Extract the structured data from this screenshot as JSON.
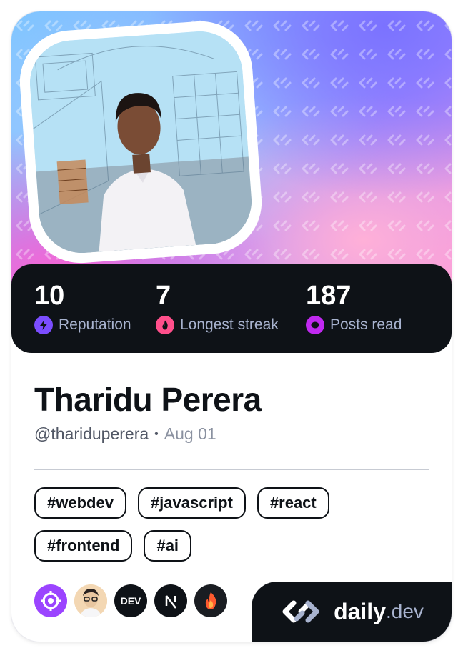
{
  "profile": {
    "name": "Tharidu Perera",
    "handle": "@thariduperera",
    "separator": "•",
    "joined": "Aug 01"
  },
  "stats": [
    {
      "value": "10",
      "label": "Reputation",
      "icon": "reputation-bolt-icon",
      "color": "#7b4dff"
    },
    {
      "value": "7",
      "label": "Longest streak",
      "icon": "streak-flame-icon",
      "color": "#ff4f8b"
    },
    {
      "value": "187",
      "label": "Posts read",
      "icon": "posts-read-icon",
      "color": "#c029f0"
    }
  ],
  "tags": [
    "#webdev",
    "#javascript",
    "#react",
    "#frontend",
    "#ai"
  ],
  "squads": [
    {
      "icon": "target-squad-icon",
      "color": "#9b44ff"
    },
    {
      "icon": "memoji-squad-icon",
      "color": "#f4d9b5"
    },
    {
      "icon": "dev-squad-icon",
      "color": "#0e1217",
      "text": "DEV"
    },
    {
      "icon": "nextjs-squad-icon",
      "color": "#0e1217"
    },
    {
      "icon": "flame-squad-icon",
      "color": "#1a1d22"
    }
  ],
  "brand": {
    "word": "daily",
    "tld": ".dev",
    "icon": "daily-dev-logo-icon"
  },
  "colors": {
    "dark": "#0e1217",
    "muted": "#a8b3cf"
  }
}
